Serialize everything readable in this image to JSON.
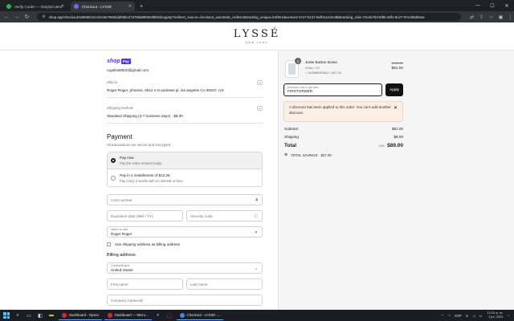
{
  "browser": {
    "tabs": [
      {
        "label": "Verify Codes — SimplyCodes",
        "active": false,
        "favicon_color": "#2fb34a"
      },
      {
        "label": "Checkout - LYSSÉ",
        "active": true,
        "favicon_color": "#7b68ee"
      }
    ],
    "url": "shop.app/checkout/16996841/cn/2c6e79682dd05be27a79da9906e9f56/shoppay?redirect_source=checkout_automatic_redirect&tracking_unique=b1f9e16ea-6ee2-47e7-b137-9ef01e244cd8&tracking_visit=72eeb753-5f9b-48f1-8c27-97ce06d04ea"
  },
  "store": {
    "logo": "LYSSÉ",
    "logo_sub": "NEW YORK"
  },
  "checkout": {
    "shop_pay_text": "shop",
    "shop_pay_badge": "Pay",
    "email": "rogelio08510@gmail.com",
    "ship_to_label": "Ship to",
    "ship_to_value": "Roger Roger, phoenix, 6912 s st andrews pl, los angeles CA 90047, US",
    "shipping_method_label": "Shipping method",
    "shipping_method_value": "Standard Shipping (3-7 business days) · $8.00",
    "payment_title": "Payment",
    "payment_sub": "All transactions are secure and encrypted.",
    "options": [
      {
        "main": "Pay now",
        "sub": "Pay the entire amount today",
        "selected": true
      },
      {
        "main": "Pay in 4 installments of $22.25",
        "sub": "Pay every 2 weeks with no interest or fees",
        "selected": false
      }
    ],
    "card_number_placeholder": "Card number",
    "expiration_placeholder": "Expiration date (MM / YY)",
    "security_placeholder": "Security code",
    "name_label": "Name on card",
    "name_value": "Roger Roger",
    "use_shipping_label": "Use shipping address as billing address",
    "billing_title": "Billing address",
    "country_label": "Country/Region",
    "country_value": "United States",
    "first_name_placeholder": "First name",
    "last_name_placeholder": "Last name",
    "company_placeholder": "Company (optional)"
  },
  "order": {
    "qty": "1",
    "product_name": "Josie Button Down",
    "product_variant": "White / XS",
    "product_discount": "SUMMERSALE / $27.00",
    "price_original": "$108.00",
    "price_now": "$81.00",
    "discount_label": "Discount code or gift card",
    "discount_value": "FIRSTORDER",
    "apply_label": "Apply",
    "notice": "A discount has been applied to this order. You can't add another discount.",
    "subtotal_label": "Subtotal",
    "subtotal_value": "$81.00",
    "shipping_label": "Shipping",
    "shipping_value": "$8.00",
    "total_label": "Total",
    "total_currency": "USD",
    "total_value": "$89.00",
    "savings_label": "TOTAL SAVINGS",
    "savings_value": "$27.00"
  },
  "taskbar": {
    "apps": [
      {
        "label": "Dashboard - Opera",
        "color": "#e0232b"
      },
      {
        "label": "Dashboard — Micro...",
        "color": "#e0232b"
      },
      {
        "label": "Checkout - LYSSÉ -...",
        "color": "#4285f4"
      }
    ],
    "lang": "ESP",
    "time": "12:24 p. m.",
    "date": "1 jul. 2024"
  }
}
